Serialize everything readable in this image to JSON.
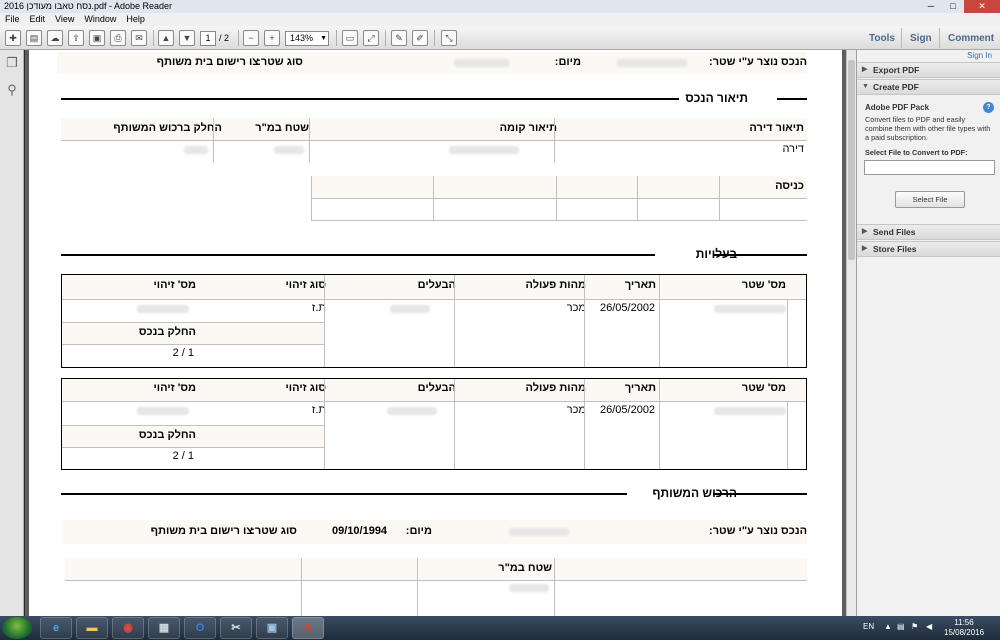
{
  "window": {
    "title": "נסח טאבו מעודכן 2016.pdf - Adobe Reader",
    "controls": {
      "minimize": "─",
      "maximize": "□",
      "close": "✕"
    }
  },
  "menu": [
    "File",
    "Edit",
    "View",
    "Window",
    "Help"
  ],
  "toolbar": {
    "current_page": "1",
    "total_pages": "/ 2",
    "zoom": "143%",
    "links": {
      "tools": "Tools",
      "sign": "Sign",
      "comment": "Comment"
    }
  },
  "right_panel": {
    "sign_in": "Sign In",
    "sections": {
      "export_pdf": "Export PDF",
      "create_pdf": "Create PDF",
      "send_files": "Send Files",
      "store_files": "Store Files"
    },
    "pack_title": "Adobe PDF Pack",
    "description": "Convert files to PDF and easily combine them with other file types with a paid subscription.",
    "select_label": "Select File to Convert to PDF:",
    "select_button": "Select File"
  },
  "document": {
    "top_row": {
      "created_label": "הנכס נוצר ע\"י שטר:",
      "date_label": "מיום:",
      "deed_type_label": "סוג שטר:",
      "deed_type_value": "צו רישום בית משותף"
    },
    "property": {
      "heading": "תיאור הנכס",
      "apartment_label": "תיאור דירה",
      "apartment_value": "דירה",
      "floor_label": "תיאור קומה",
      "area_label": "שטח במ\"ר",
      "share_label": "החלק ברכוש המשותף",
      "entrance_label": "כניסה"
    },
    "ownership": {
      "heading": "בעלויות",
      "headers": {
        "deed_no": "מס' שטר",
        "date": "תאריך",
        "action": "מהות פעולה",
        "owners": "הבעלים",
        "id_type": "סוג זיהוי",
        "id_no": "מס' זיהוי"
      },
      "share_label": "החלק בנכס",
      "rows": [
        {
          "date": "26/05/2002",
          "action": "מכר",
          "id_type": "ת.ז",
          "share": "1 / 2"
        },
        {
          "date": "26/05/2002",
          "action": "מכר",
          "id_type": "ת.ז",
          "share": "1 / 2"
        }
      ]
    },
    "common_property": {
      "heading": "הרכוש המשותף",
      "created_label": "הנכס נוצר ע\"י שטר:",
      "date_label": "מיום:",
      "date_value": "09/10/1994",
      "deed_type_label": "סוג שטר:",
      "deed_type_value": "צו רישום בית משותף",
      "area_label": "שטח במ\"ר"
    }
  },
  "taskbar": {
    "lang": "EN",
    "time": "11:56",
    "date": "15/08/2016"
  }
}
